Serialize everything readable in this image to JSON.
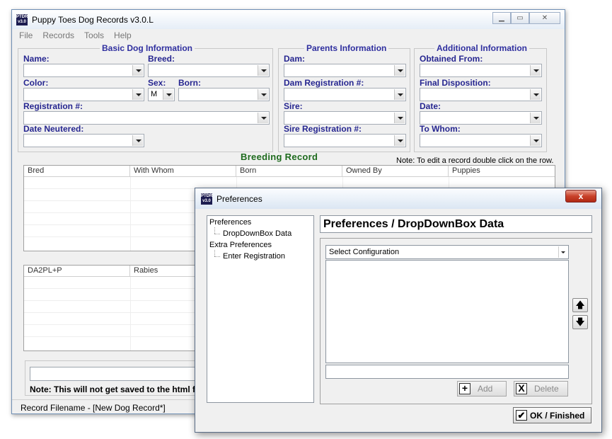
{
  "main_window": {
    "icon_text": "PTDR v3.0",
    "title": "Puppy Toes Dog Records v3.0.L",
    "menu": [
      "File",
      "Records",
      "Tools",
      "Help"
    ],
    "basic": {
      "legend": "Basic Dog Information",
      "name_label": "Name:",
      "breed_label": "Breed:",
      "color_label": "Color:",
      "sex_label": "Sex:",
      "sex_value": "M",
      "born_label": "Born:",
      "registration_label": "Registration #:",
      "date_neutered_label": "Date Neutered:"
    },
    "parents": {
      "legend": "Parents Information",
      "dam_label": "Dam:",
      "dam_reg_label": "Dam Registration #:",
      "sire_label": "Sire:",
      "sire_reg_label": "Sire Registration #:"
    },
    "additional": {
      "legend": "Additional Information",
      "obtained_label": "Obtained From:",
      "disposition_label": "Final Disposition:",
      "date_label": "Date:",
      "to_whom_label": "To Whom:"
    },
    "breeding_title": "Breeding Record",
    "breeding_note": "Note: To edit a record double click on the row.",
    "breeding_columns": [
      "Bred",
      "With Whom",
      "Born",
      "Owned By",
      "Puppies"
    ],
    "vaccine_columns": [
      "DA2PL+P",
      "Rabies"
    ],
    "note_text": "Note: This will not get saved to the html fi",
    "status": "Record Filename - [New Dog Record*]"
  },
  "preferences": {
    "icon_text": "PTDR v3.0",
    "title": "Preferences",
    "close_symbol": "x",
    "tree": {
      "root1": "Preferences",
      "child1": "DropDownBox Data",
      "root2": "Extra Preferences",
      "child2": "Enter Registration"
    },
    "header": "Preferences / DropDownBox Data",
    "config_select": "Select Configuration",
    "add_label": "Add",
    "delete_label": "Delete",
    "add_symbol": "+",
    "delete_symbol": "X",
    "up_symbol": "🡅",
    "down_symbol": "🡇",
    "ok_symbol": "✔",
    "ok_label": "OK / Finished"
  }
}
